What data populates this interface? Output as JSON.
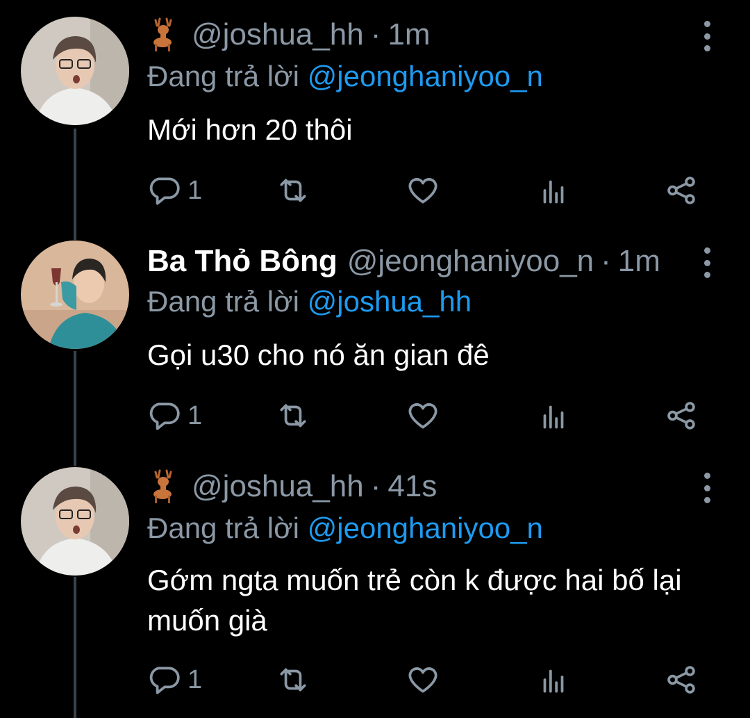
{
  "colors": {
    "background": "#000000",
    "secondary_text": "#8b98a5",
    "mention": "#1d9bf0",
    "thread_line": "#38444d"
  },
  "icons": {
    "name_emoji": "deer-icon",
    "reply": "reply-icon",
    "retweet": "retweet-icon",
    "like": "heart-icon",
    "analytics": "analytics-icon",
    "share": "share-icon",
    "more": "more-vertical-icon"
  },
  "tweets": [
    {
      "display_name": "",
      "handle": "@joshua_hh",
      "separator": "·",
      "time": "1m",
      "reply_prefix": "Đang trả lời",
      "reply_to": "@jeonghaniyoo_n",
      "text": "Mới hơn 20 thôi",
      "reply_count": "1"
    },
    {
      "display_name": "Ba Thỏ Bông",
      "handle": "@jeonghaniyoo_n",
      "separator": "·",
      "time": "1m",
      "reply_prefix": "Đang trả lời",
      "reply_to": "@joshua_hh",
      "text": "Gọi u30 cho nó ăn gian đê",
      "reply_count": "1"
    },
    {
      "display_name": "",
      "handle": "@joshua_hh",
      "separator": "·",
      "time": "41s",
      "reply_prefix": "Đang trả lời",
      "reply_to": "@jeonghaniyoo_n",
      "text": "Gớm ngta muốn trẻ còn k được hai bố lại muốn già",
      "reply_count": "1"
    }
  ]
}
